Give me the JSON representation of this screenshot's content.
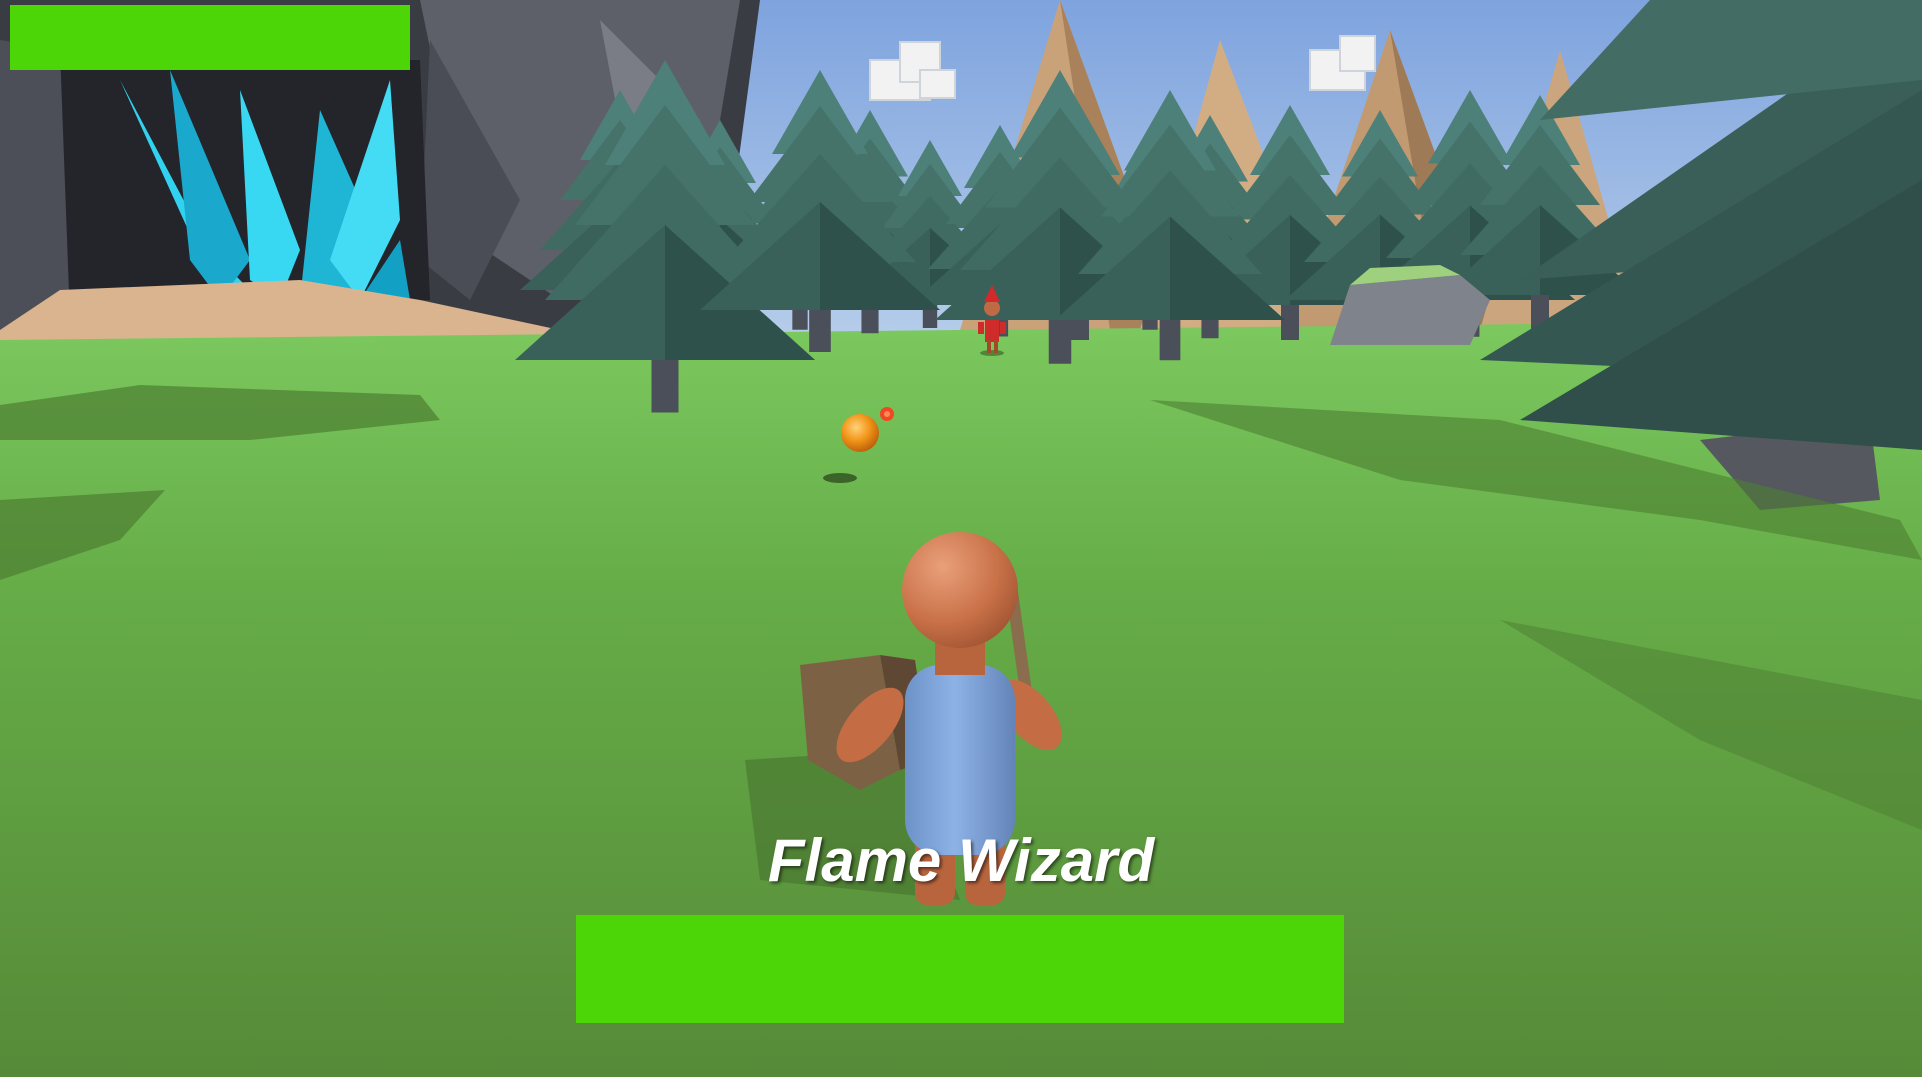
{
  "hud": {
    "player_health": {
      "fraction": 1.0,
      "color": "#4cd608"
    },
    "boss": {
      "name": "Flame Wizard",
      "health_fraction": 1.0,
      "bar_color": "#4cd608"
    }
  },
  "palette": {
    "sky": "#8fb3e8",
    "grass_light": "#75c65a",
    "grass_dark": "#5a8f3c",
    "tree": "#3f6f66",
    "tree_dark": "#2f5550",
    "crystal": "#27c8e6",
    "mountain": "#c9a27a",
    "cliff": "#4b4e57",
    "player_skin": "#d9804f",
    "player_shirt": "#7ea6dc",
    "enemy": "#d22a2a",
    "fireball": "#f29a16"
  },
  "icons": {
    "player": "player-character-icon",
    "enemy": "flame-wizard-icon",
    "projectile": "fireball-icon"
  }
}
